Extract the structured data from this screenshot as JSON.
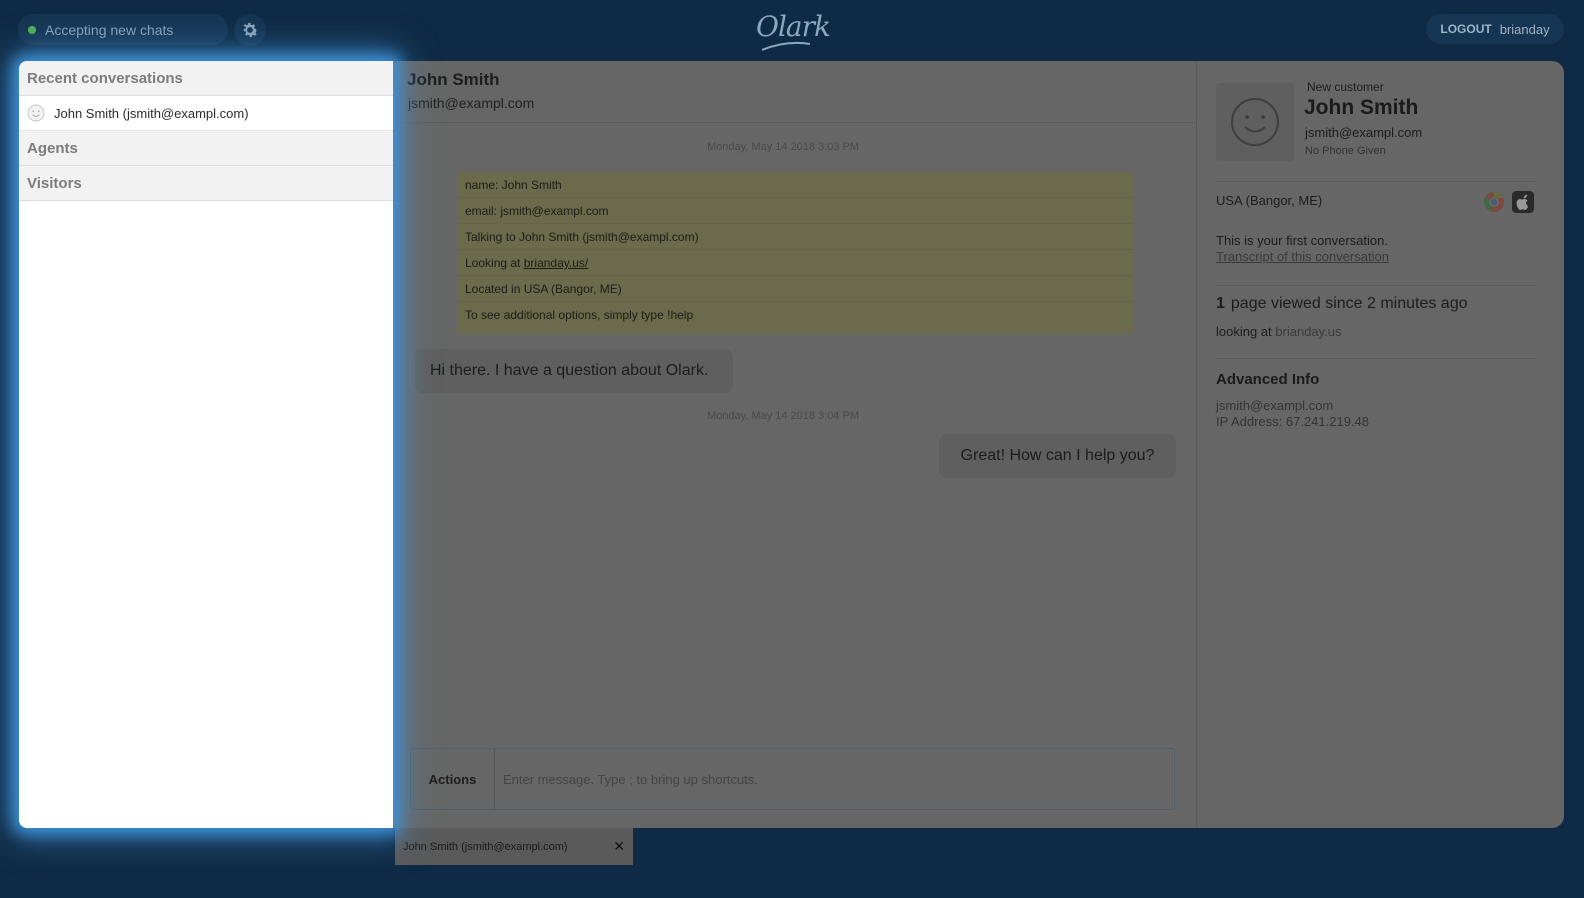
{
  "topbar": {
    "status_label": "Accepting new chats",
    "status_color": "#4caf50",
    "logo_text": "Olark",
    "logout_label": "LOGOUT",
    "username": "brianday"
  },
  "sidebar": {
    "recent_title": "Recent conversations",
    "conversations": [
      {
        "label": "John Smith (jsmith@exampl.com)"
      }
    ],
    "agents_title": "Agents",
    "visitors_title": "Visitors"
  },
  "chat": {
    "header_name": "John Smith",
    "header_email": "jsmith@exampl.com",
    "timestamp_1": "Monday, May 14 2018 3:03 PM",
    "system_lines": {
      "name": "name: John Smith",
      "email": "email: jsmith@exampl.com",
      "talking": "Talking to John Smith (jsmith@exampl.com)",
      "looking_prefix": "Looking at",
      "looking_link": "brianday.us/",
      "located": "Located in USA (Bangor, ME)",
      "options": "To see additional options, simply type !help"
    },
    "visitor_message": "Hi there. I have a question about Olark.",
    "timestamp_2": "Monday, May 14 2018 3:04 PM",
    "agent_message": "Great! How can I help you?",
    "composer": {
      "actions_label": "Actions",
      "placeholder": "Enter message. Type ; to bring up shortcuts."
    }
  },
  "visitor_panel": {
    "tag": "New customer",
    "name": "John Smith",
    "email": "jsmith@exampl.com",
    "phone": "No Phone Given",
    "location": "USA (Bangor, ME)",
    "first_conversation": "This is your first conversation.",
    "transcript_link": "Transcript of this conversation",
    "pages_count": "1",
    "pages_text": "page viewed since 2 minutes ago",
    "looking_prefix": "looking at",
    "looking_url": "brianday.us",
    "advanced_title": "Advanced Info",
    "advanced_email": "jsmith@exampl.com",
    "ip_address": "IP Address: 67.241.219.48",
    "browser_icons": [
      "chrome-icon",
      "apple-icon"
    ]
  },
  "bottom_tab": {
    "label": "John Smith (jsmith@exampl.com)",
    "close_glyph": "✕"
  }
}
